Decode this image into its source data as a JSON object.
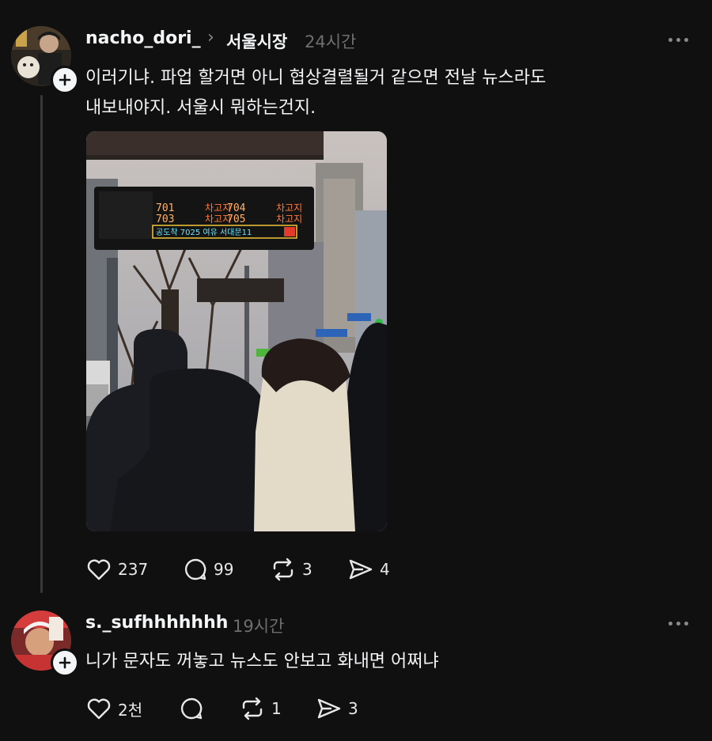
{
  "post": {
    "username": "nacho_dori_",
    "topic": "서울시장",
    "time": "24시간",
    "lines": [
      "이러기냐. 파업 할거면 아니 협상결렬될거 같으면 전날 뉴스라도",
      "내보내야지. 서울시 뭐하는건지."
    ],
    "photo": {
      "sign_routes": [
        "701",
        "704",
        "703",
        "705"
      ],
      "sign_status": [
        "차고지",
        "차고지",
        "차고지",
        "차고지"
      ],
      "sign_footer": "공도착 7025 여유 서대문11"
    },
    "stats": {
      "likes": "237",
      "comments": "99",
      "reposts": "3",
      "shares": "4"
    }
  },
  "reply": {
    "username": "s._sufhhhhhhh",
    "time": "19시간",
    "text": "니가 문자도 꺼놓고 뉴스도 안보고 화내면 어쩌냐",
    "stats": {
      "likes": "2천",
      "comments": "",
      "reposts": "1",
      "shares": "3"
    }
  },
  "icons": [
    "heart-icon",
    "comment-icon",
    "repost-icon",
    "share-icon",
    "more-icon",
    "plus-icon",
    "chevron-right-icon"
  ],
  "colors": {
    "background": "#101010",
    "text": "#f3f5f7",
    "muted": "#6e6e6e",
    "thread_line": "#383838"
  }
}
